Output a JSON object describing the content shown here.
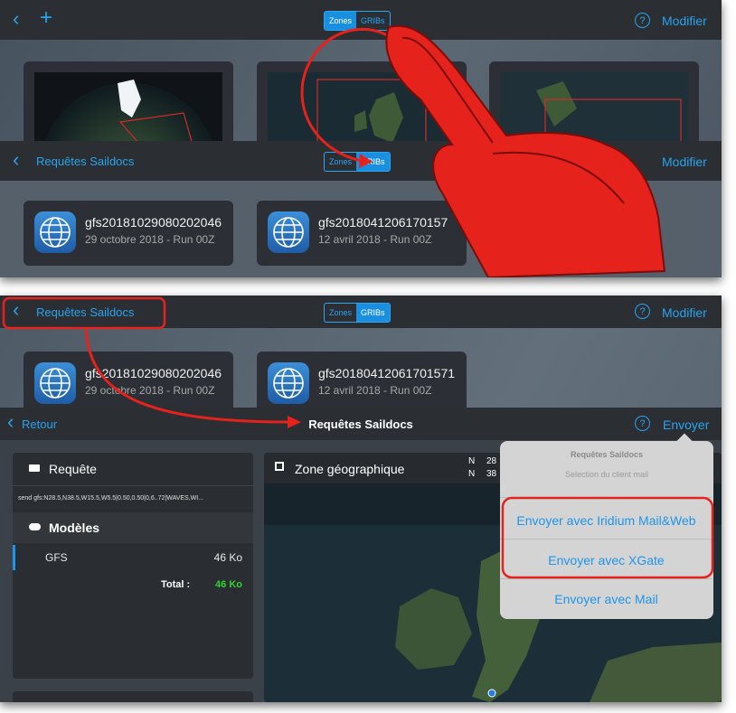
{
  "top_screen": {
    "seg_zones": "Zones",
    "seg_gribs": "GRIBs",
    "modify": "Modifier",
    "help_glyph": "?"
  },
  "overlay_screen": {
    "back_label": "Requêtes Saildocs",
    "seg_zones": "Zones",
    "seg_gribs": "GRIBs",
    "modify": "Modifier"
  },
  "gribs": [
    {
      "name": "gfs20181029080202046",
      "date": "29 octobre 2018 - Run 00Z"
    },
    {
      "name": "gfs20180412061701571",
      "date": "12 avril 2018 - Run 00Z"
    }
  ],
  "gribs_cropped": [
    {
      "name": "gfs20181029080202046",
      "date": "29 octobre 2018 - Run 00Z"
    },
    {
      "name": "gfs2018041206170157",
      "date": "12 avril 2018 - Run 00Z"
    }
  ],
  "list_screen": {
    "back_label": "Requêtes Saildocs",
    "seg_zones": "Zones",
    "seg_gribs": "GRIBs",
    "modify": "Modifier"
  },
  "detail_screen": {
    "back_label": "Retour",
    "title": "Requêtes Saildocs",
    "send": "Envoyer",
    "request_header": "Requête",
    "request_text": "send gfs:N28.5,N38.5,W15.5,W5.5|0.50,0.50|0,6..72|WAVES,WI...",
    "models_header": "Modèles",
    "model_name": "GFS",
    "model_size": "46 Ko",
    "total_label": "Total :",
    "total_value": "46 Ko",
    "zone_header": "Zone géographique",
    "coord_n1": "N",
    "coord_n1_val": "28",
    "coord_n2": "N",
    "coord_n2_val": "38"
  },
  "popover": {
    "title": "Requêtes Saildocs",
    "subtitle": "Selection du client mail",
    "options": [
      "Envoyer avec Iridium Mail&Web",
      "Envoyer avec XGate",
      "Envoyer avec Mail"
    ]
  },
  "colors": {
    "accent": "#29a3ee",
    "highlight_red": "#e5221b",
    "total_green": "#2fd42f"
  }
}
